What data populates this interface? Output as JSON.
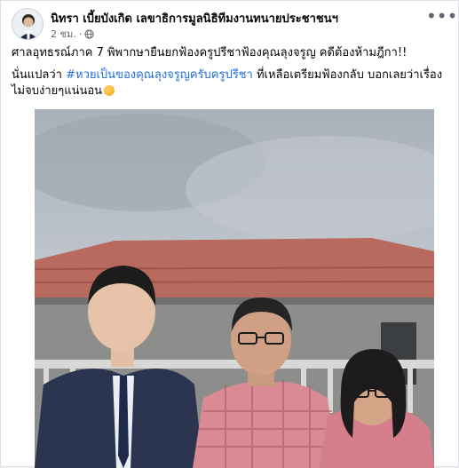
{
  "post": {
    "author": "นิทรา เบี้ยบังเกิด เลขาธิการมูลนิธิทีมงานทนายประชาชนฯ",
    "time": "2 ชม.",
    "more_icon": "ellipsis-icon",
    "privacy_icon": "globe-icon",
    "line1": "ศาลอุทธรณ์ภาค 7 พิพากษายืนยกฟ้องครูปรีชาฟ้องคุณลุงจรูญ คดีต้องห้ามฎีกา!!",
    "line2_prefix": "นั่นแปลว่า ",
    "hashtag": "#หวยเป็นของคุณลุงจรูญครับครูปรีชา",
    "line2_suffix": " ที่เหลือเตรียมฟ้องกลับ บอกเลยว่าเรื่องไม่จบง่ายๆแน่นอน"
  },
  "colors": {
    "link": "#216fdb",
    "text": "#050505",
    "meta": "#65676b"
  }
}
